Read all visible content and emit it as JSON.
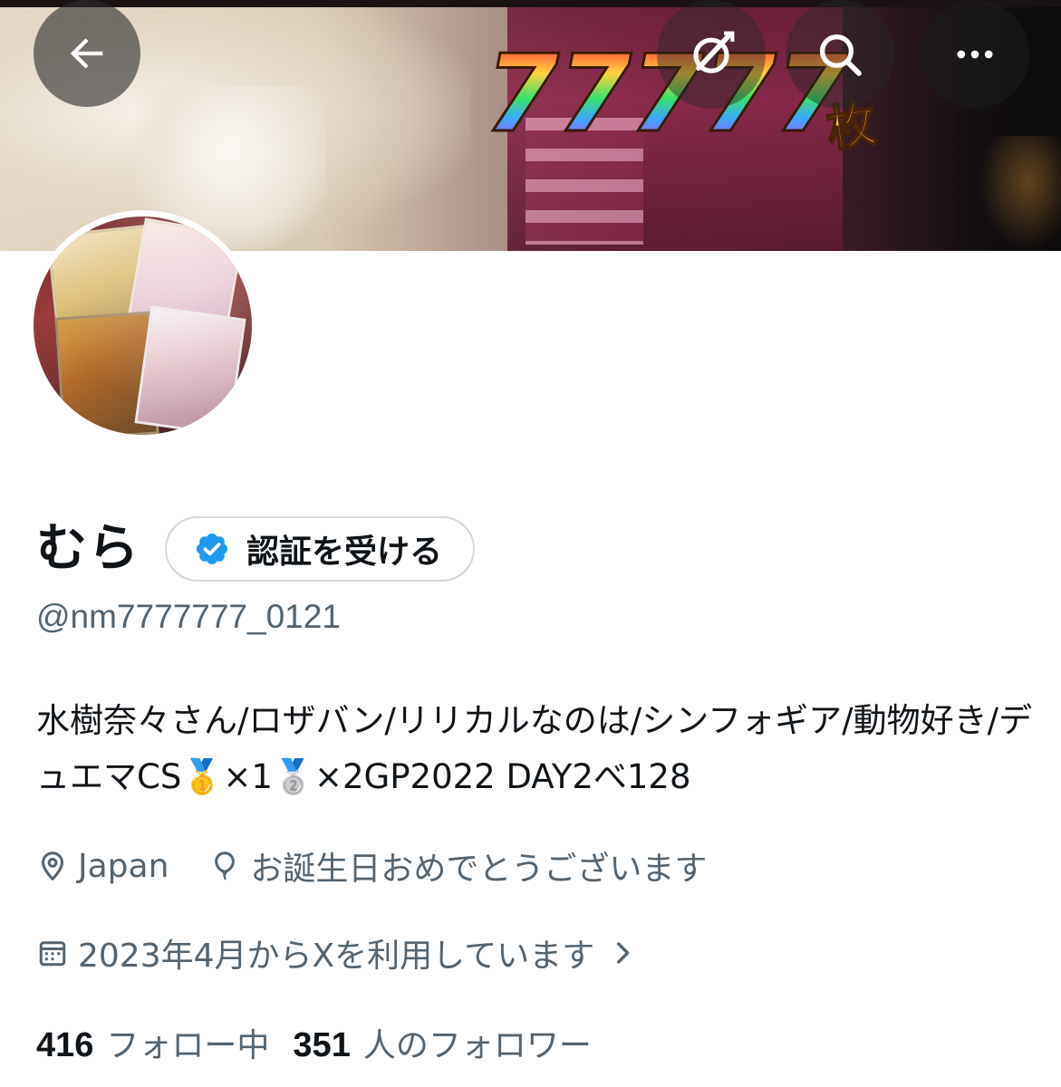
{
  "banner": {
    "sevens": [
      "7",
      "7",
      "7",
      "7",
      "7"
    ],
    "unit": "枚"
  },
  "nav": {
    "back_icon": "arrow-left-icon",
    "grok_icon": "grok-icon",
    "search_icon": "search-icon",
    "more_icon": "more-horizontal-icon"
  },
  "profile": {
    "display_name": "むら",
    "verify_label": "認証を受ける",
    "handle": "@nm7777777_0121",
    "bio": "水樹奈々さん/ロザバン/リリカルなのは/シンフォギア/動物好き/デュエマCS🥇×1🥈×2GP2022 DAY2べ128",
    "location": "Japan",
    "birthday_text": "お誕生日おめでとうございます",
    "joined_text": "2023年4月からXを利用しています"
  },
  "stats": {
    "following_count": "416",
    "following_label": "フォロー中",
    "followers_count": "351",
    "followers_label": "人のフォロワー"
  },
  "colors": {
    "text_primary": "#0f1419",
    "text_secondary": "#536471",
    "verified_blue": "#1d9bf0",
    "border": "#cfd9de"
  }
}
